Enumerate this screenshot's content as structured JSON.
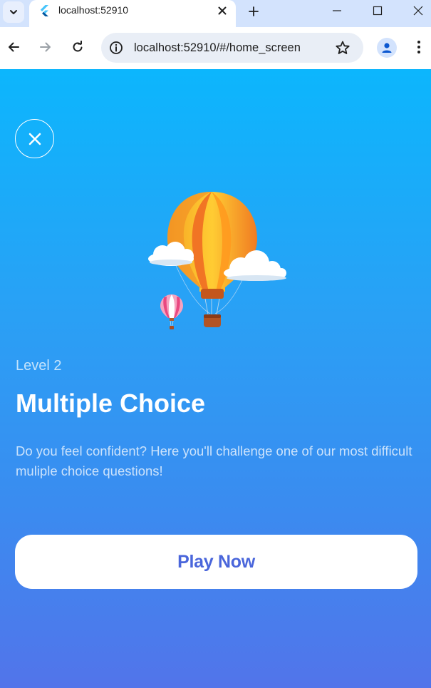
{
  "browser": {
    "tab_title": "localhost:52910",
    "url": "localhost:52910/#/home_screen"
  },
  "icons": {
    "tab_menu": "chevron-down-icon",
    "favicon": "flutter-icon",
    "tab_close": "close-icon",
    "new_tab": "plus-icon",
    "minimize": "minimize-icon",
    "maximize": "maximize-icon",
    "window_close": "close-icon",
    "back": "arrow-left-icon",
    "forward": "arrow-right-icon",
    "reload": "reload-icon",
    "site_info": "info-icon",
    "bookmark": "star-icon",
    "profile": "person-icon",
    "menu": "kebab-menu-icon",
    "app_close": "close-icon",
    "illustration": "hot-air-balloons-illustration"
  },
  "app": {
    "level": "Level 2",
    "title": "Multiple Choice",
    "description": "Do you feel confident? Here you'll challenge one of our most difficult muliple choice questions!",
    "play_button": "Play Now"
  },
  "colors": {
    "gradient_top": "#0cb6fd",
    "gradient_bottom": "#5274ea",
    "button_text": "#4a66db",
    "button_bg": "#ffffff"
  }
}
